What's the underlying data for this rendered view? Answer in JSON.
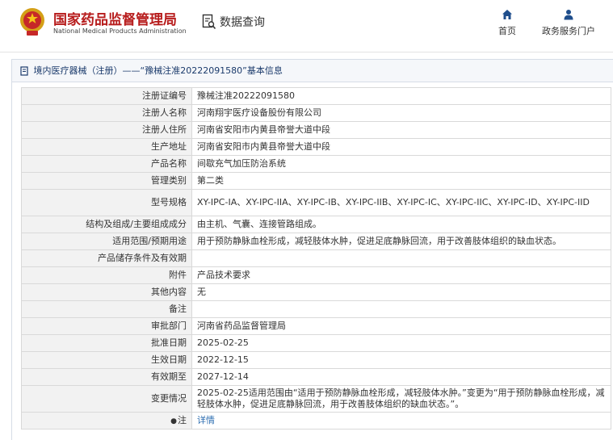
{
  "header": {
    "brand_cn": "国家药品监督管理局",
    "brand_en": "National Medical Products Administration",
    "query_label": "数据查询",
    "nav": [
      {
        "label": "首页",
        "icon": "home-icon"
      },
      {
        "label": "政务服务门户",
        "icon": "user-icon"
      }
    ],
    "colors": {
      "brand": "#b71c1c",
      "nav_icon": "#1f4e8c"
    }
  },
  "panel": {
    "title": "境内医疗器械（注册）——“豫械注准20222091580”基本信息"
  },
  "rows": [
    {
      "label": "注册证编号",
      "value": "豫械注准20222091580"
    },
    {
      "label": "注册人名称",
      "value": "河南翔宇医疗设备股份有限公司"
    },
    {
      "label": "注册人住所",
      "value": "河南省安阳市内黄县帝誉大道中段"
    },
    {
      "label": "生产地址",
      "value": "河南省安阳市内黄县帝誉大道中段"
    },
    {
      "label": "产品名称",
      "value": "间歇充气加压防治系统"
    },
    {
      "label": "管理类别",
      "value": "第二类"
    },
    {
      "label": "型号规格",
      "value": "XY-IPC-IA、XY-IPC-IIA、XY-IPC-IB、XY-IPC-IIB、XY-IPC-IC、XY-IPC-IIC、XY-IPC-ID、XY-IPC-IID"
    },
    {
      "label": "结构及组成/主要组成成分",
      "value": "由主机、气囊、连接管路组成。"
    },
    {
      "label": "适用范围/预期用途",
      "value": "用于预防静脉血栓形成，减轻肢体水肿，促进足底静脉回流，用于改善肢体组织的缺血状态。"
    },
    {
      "label": "产品储存条件及有效期",
      "value": ""
    },
    {
      "label": "附件",
      "value": "产品技术要求"
    },
    {
      "label": "其他内容",
      "value": "无"
    },
    {
      "label": "备注",
      "value": ""
    },
    {
      "label": "审批部门",
      "value": "河南省药品监督管理局"
    },
    {
      "label": "批准日期",
      "value": "2025-02-25"
    },
    {
      "label": "生效日期",
      "value": "2022-12-15"
    },
    {
      "label": "有效期至",
      "value": "2027-12-14"
    },
    {
      "label": "变更情况",
      "value": "2025-02-25适用范围由“适用于预防静脉血栓形成，减轻肢体水肿。”变更为“用于预防静脉血栓形成，减轻肢体水肿，促进足底静脉回流，用于改善肢体组织的缺血状态。”。"
    }
  ],
  "note_row": {
    "label": "注",
    "link": "详情"
  }
}
